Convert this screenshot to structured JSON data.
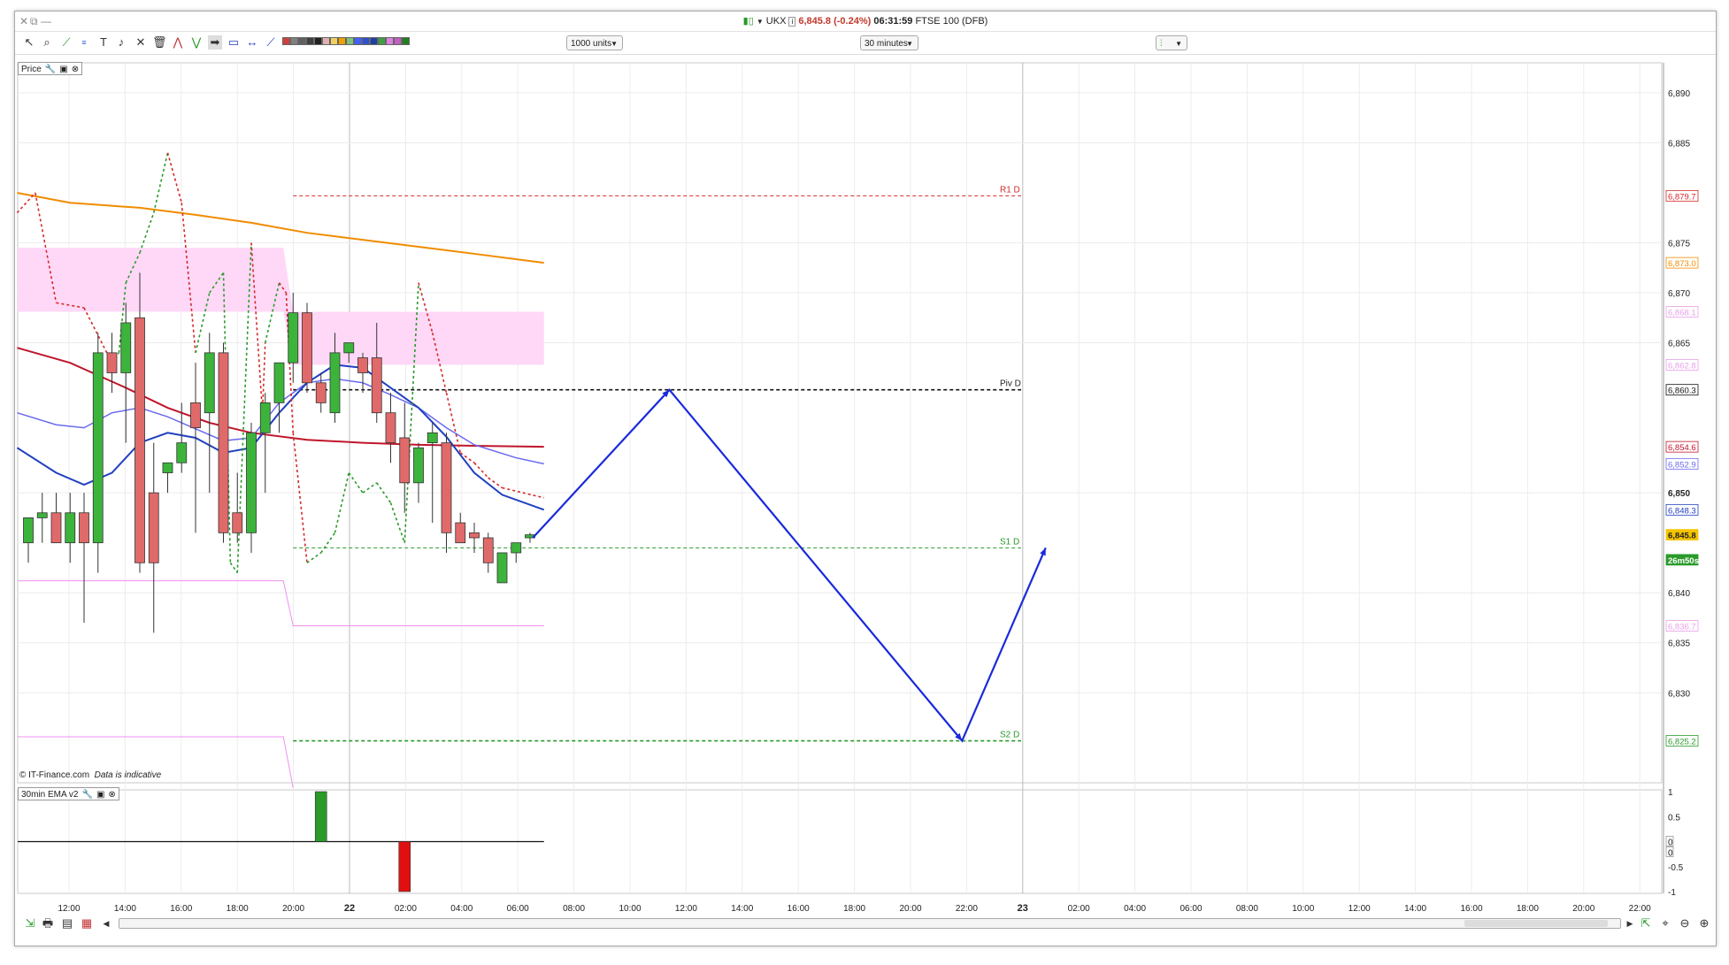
{
  "window": {
    "controls": [
      "✕",
      "⧉",
      "—"
    ],
    "title": {
      "symbol": "UKX",
      "price": "6,845.8 (-0.24%)",
      "time": "06:31:59",
      "instrument": "FTSE 100 (DFB)"
    }
  },
  "toolbar": {
    "icons": [
      "pointer-icon",
      "zoom-icon",
      "trendline-icon",
      "fibonacci-icon",
      "text-icon",
      "alert-icon",
      "tools-icon",
      "delete-icon",
      "pattern-icon",
      "zigzag-icon",
      "arrow-icon",
      "shape-icon",
      "measure-icon",
      "line-icon"
    ],
    "color_swatches": [
      "#d04040",
      "#808080",
      "#606060",
      "#404040",
      "#202020",
      "#e0b0b0",
      "#f0d060",
      "#f0a000",
      "#80c080",
      "#4060ff",
      "#3050d0",
      "#2040a0",
      "#40a040",
      "#e080e0",
      "#c060c0",
      "#208020"
    ],
    "units_select": "1000 units",
    "timeframe_select": "30 minutes"
  },
  "panels": {
    "price_label": "Price",
    "indicator_label": "30min EMA v2",
    "copyright": "© IT-Finance.com",
    "disclaimer": "Data is indicative"
  },
  "chart_data": [
    {
      "type": "candlestick",
      "panel": "Price",
      "y_range": [
        6821,
        6893
      ],
      "x_axis_ticks": [
        "12:00",
        "14:00",
        "16:00",
        "18:00",
        "20:00",
        "22",
        "02:00",
        "04:00",
        "06:00",
        "08:00",
        "10:00",
        "12:00",
        "14:00",
        "16:00",
        "18:00",
        "20:00",
        "22:00",
        "23",
        "02:00",
        "04:00",
        "06:00",
        "08:00",
        "10:00",
        "12:00",
        "14:00",
        "16:00",
        "18:00",
        "20:00",
        "22:00"
      ],
      "y_axis_ticks": [
        "6,890",
        "6,885",
        "6,875",
        "6,870",
        "6,865",
        "6,850",
        "6,840",
        "6,835",
        "6,830"
      ],
      "bold_tick": "6,850",
      "candles": [
        {
          "o": 6845,
          "h": 6847,
          "l": 6843,
          "c": 6847.5,
          "x": 0
        },
        {
          "o": 6847.5,
          "h": 6850,
          "l": 6845,
          "c": 6848,
          "x": 1
        },
        {
          "o": 6848,
          "h": 6850,
          "l": 6845,
          "c": 6845,
          "x": 2
        },
        {
          "o": 6845,
          "h": 6850,
          "l": 6843,
          "c": 6848,
          "x": 3
        },
        {
          "o": 6848,
          "h": 6850,
          "l": 6837,
          "c": 6845,
          "x": 4
        },
        {
          "o": 6845,
          "h": 6866,
          "l": 6842,
          "c": 6864,
          "x": 5
        },
        {
          "o": 6864,
          "h": 6866,
          "l": 6860,
          "c": 6862,
          "x": 6
        },
        {
          "o": 6862,
          "h": 6869,
          "l": 6855,
          "c": 6867,
          "x": 7
        },
        {
          "o": 6867.5,
          "h": 6872,
          "l": 6842,
          "c": 6843,
          "x": 8
        },
        {
          "o": 6850,
          "h": 6855,
          "l": 6836,
          "c": 6843,
          "x": 9
        },
        {
          "o": 6852,
          "h": 6853,
          "l": 6850,
          "c": 6853,
          "x": 10
        },
        {
          "o": 6853,
          "h": 6859,
          "l": 6852,
          "c": 6855,
          "x": 11
        },
        {
          "o": 6859,
          "h": 6863,
          "l": 6846,
          "c": 6856.5,
          "x": 12
        },
        {
          "o": 6858,
          "h": 6866,
          "l": 6850,
          "c": 6864,
          "x": 13
        },
        {
          "o": 6864,
          "h": 6865,
          "l": 6845,
          "c": 6846,
          "x": 14
        },
        {
          "o": 6848,
          "h": 6852,
          "l": 6845,
          "c": 6846,
          "x": 15
        },
        {
          "o": 6846,
          "h": 6857,
          "l": 6844,
          "c": 6856,
          "x": 16
        },
        {
          "o": 6856,
          "h": 6860,
          "l": 6850,
          "c": 6859,
          "x": 17
        },
        {
          "o": 6859,
          "h": 6863,
          "l": 6856,
          "c": 6863,
          "x": 18
        },
        {
          "o": 6863,
          "h": 6870,
          "l": 6861,
          "c": 6868,
          "x": 19
        },
        {
          "o": 6868,
          "h": 6869,
          "l": 6860,
          "c": 6861,
          "x": 20
        },
        {
          "o": 6861,
          "h": 6862,
          "l": 6858,
          "c": 6859,
          "x": 21
        },
        {
          "o": 6858,
          "h": 6866,
          "l": 6857,
          "c": 6864,
          "x": 22
        },
        {
          "o": 6864,
          "h": 6865,
          "l": 6863,
          "c": 6865,
          "x": 23
        },
        {
          "o": 6863.5,
          "h": 6864,
          "l": 6860,
          "c": 6862,
          "x": 24
        },
        {
          "o": 6863.5,
          "h": 6867,
          "l": 6857,
          "c": 6858,
          "x": 25
        },
        {
          "o": 6858,
          "h": 6860,
          "l": 6853,
          "c": 6855,
          "x": 26
        },
        {
          "o": 6855.5,
          "h": 6859,
          "l": 6848,
          "c": 6851,
          "x": 27
        },
        {
          "o": 6851,
          "h": 6855,
          "l": 6849,
          "c": 6854.5,
          "x": 28
        },
        {
          "o": 6855,
          "h": 6857,
          "l": 6847,
          "c": 6856,
          "x": 29
        },
        {
          "o": 6855,
          "h": 6856,
          "l": 6844,
          "c": 6846,
          "x": 30
        },
        {
          "o": 6847,
          "h": 6848,
          "l": 6845,
          "c": 6845,
          "x": 31
        },
        {
          "o": 6846,
          "h": 6847,
          "l": 6844,
          "c": 6845.5,
          "x": 32
        },
        {
          "o": 6845.5,
          "h": 6846,
          "l": 6842,
          "c": 6843,
          "x": 33
        },
        {
          "o": 6841,
          "h": 6844,
          "l": 6841,
          "c": 6844,
          "x": 34
        },
        {
          "o": 6844,
          "h": 6845,
          "l": 6843,
          "c": 6845,
          "x": 35
        },
        {
          "o": 6845.5,
          "h": 6846,
          "l": 6845,
          "c": 6845.8,
          "x": 36
        }
      ],
      "pivot_levels": [
        {
          "name": "R1 D",
          "value": 6879.7,
          "color": "#d62828"
        },
        {
          "name": "Piv D",
          "value": 6860.3,
          "color": "#111111"
        },
        {
          "name": "S1 D",
          "value": 6844.5,
          "color": "#2a9a2a"
        },
        {
          "name": "S2 D",
          "value": 6825.2,
          "color": "#2a9a2a"
        }
      ],
      "price_labels": [
        {
          "text": "6,879.7",
          "color": "#d62828"
        },
        {
          "text": "6,873.0",
          "color": "#f08c00"
        },
        {
          "text": "6,868.1",
          "color": "#e8a0e8"
        },
        {
          "text": "6,862.8",
          "color": "#e8a0e8"
        },
        {
          "text": "6,860.3",
          "color": "#111111"
        },
        {
          "text": "6,854.6",
          "color": "#c0162b"
        },
        {
          "text": "6,852.9",
          "color": "#6a6af0"
        },
        {
          "text": "6,848.3",
          "color": "#2040c0"
        },
        {
          "text": "6,845.8",
          "color": "#222222",
          "bg": "#f5c400"
        },
        {
          "text": "26m50s",
          "color": "#ffffff",
          "bg": "#2a9a2a"
        },
        {
          "text": "6,836.7",
          "color": "#e8a0e8"
        },
        {
          "text": "6,825.2",
          "color": "#2a9a2a"
        }
      ],
      "projection_path": [
        {
          "x": 36.2,
          "y": 6845.5
        },
        {
          "x": 46,
          "y": 6860.3
        },
        {
          "x": 67,
          "y": 6825.2
        },
        {
          "x": 73,
          "y": 6844.5
        }
      ]
    },
    {
      "type": "bar",
      "panel": "30min EMA v2",
      "y_range": [
        -1,
        1
      ],
      "y_axis_ticks": [
        "1",
        "0.5",
        "0",
        "0",
        "-0.5",
        "-1"
      ],
      "bars": [
        {
          "x": 21,
          "value": 1,
          "color": "#2a9a2a"
        },
        {
          "x": 27,
          "value": -1,
          "color": "#e01010"
        }
      ]
    }
  ],
  "bottombar": {
    "icons": [
      "auto-scroll-icon",
      "print-icon",
      "properties-icon",
      "template-icon"
    ],
    "right_icons": [
      "zoom-fit-icon",
      "zoom-reset-icon",
      "zoom-out-icon",
      "zoom-in-icon"
    ]
  }
}
